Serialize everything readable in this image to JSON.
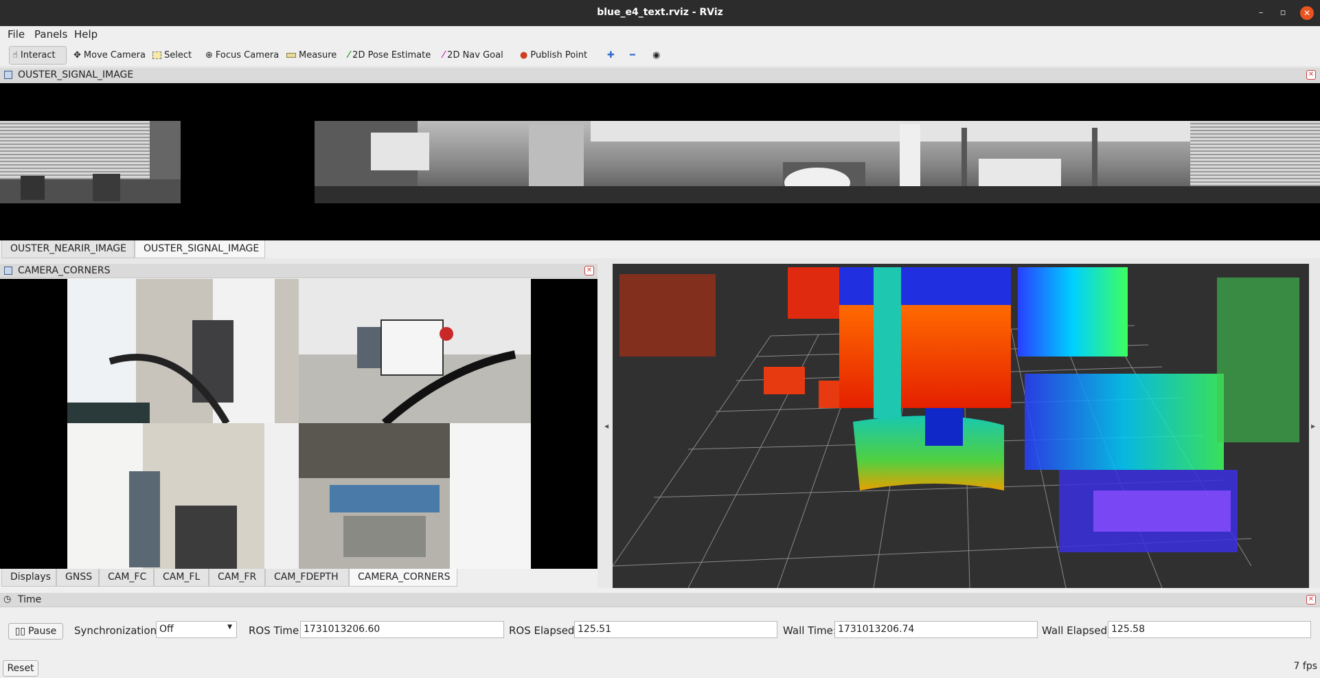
{
  "window": {
    "title": "blue_e4_text.rviz - RViz"
  },
  "menu": [
    "File",
    "Panels",
    "Help"
  ],
  "toolbar": {
    "interact": "Interact",
    "move_camera": "Move Camera",
    "select": "Select",
    "focus_camera": "Focus Camera",
    "measure": "Measure",
    "pose_estimate": "2D Pose Estimate",
    "nav_goal": "2D Nav Goal",
    "publish_point": "Publish Point"
  },
  "ouster_panel": {
    "title": "OUSTER_SIGNAL_IMAGE"
  },
  "ouster_tabs": [
    "OUSTER_NEARIR_IMAGE",
    "OUSTER_SIGNAL_IMAGE"
  ],
  "camera_panel": {
    "title": "CAMERA_CORNERS"
  },
  "bottom_tabs": [
    "Displays",
    "GNSS",
    "CAM_FC",
    "CAM_FL",
    "CAM_FR",
    "CAM_FDEPTH",
    "CAMERA_CORNERS"
  ],
  "time_panel": {
    "title": "Time",
    "pause_label": "Pause",
    "sync_label": "Synchronization:",
    "sync_value": "Off",
    "ros_time_label": "ROS Time:",
    "ros_time_value": "1731013206.60",
    "ros_elapsed_label": "ROS Elapsed:",
    "ros_elapsed_value": "125.51",
    "wall_time_label": "Wall Time:",
    "wall_time_value": "1731013206.74",
    "wall_elapsed_label": "Wall Elapsed:",
    "wall_elapsed_value": "125.58"
  },
  "status": {
    "reset_label": "Reset",
    "fps": "7 fps"
  },
  "colors": {
    "titlebar": "#2c2c2c",
    "viewport_bg": "#303030",
    "close_accent": "#e95420"
  }
}
